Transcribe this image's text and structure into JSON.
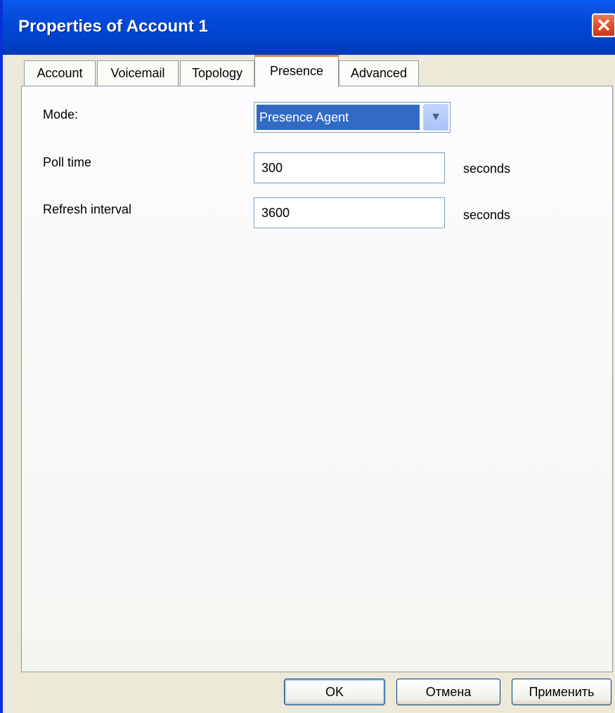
{
  "window": {
    "title": "Properties of Account 1",
    "close_glyph": "✕"
  },
  "tabs": [
    {
      "label": "Account",
      "active": false
    },
    {
      "label": "Voicemail",
      "active": false
    },
    {
      "label": "Topology",
      "active": false
    },
    {
      "label": "Presence",
      "active": true
    },
    {
      "label": "Advanced",
      "active": false
    }
  ],
  "presence": {
    "mode_label": "Mode:",
    "mode_value": "Presence Agent",
    "poll_label": "Poll time",
    "poll_value": "300",
    "poll_unit": "seconds",
    "refresh_label": "Refresh interval",
    "refresh_value": "3600",
    "refresh_unit": "seconds"
  },
  "buttons": {
    "ok": "OK",
    "cancel": "Отмена",
    "apply": "Применить"
  },
  "colors": {
    "titlebar": "#0149d6",
    "selection": "#316ac5",
    "active_tab_accent": "#e68b2c",
    "close_button": "#e04a24"
  }
}
